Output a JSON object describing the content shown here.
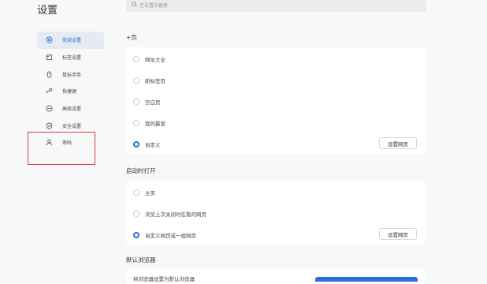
{
  "header": {
    "title": "设置",
    "search_placeholder": "在设置中搜索"
  },
  "sidebar": {
    "items": [
      {
        "label": "常规设置",
        "icon": "settings-circle-icon",
        "active": true
      },
      {
        "label": "标签设置",
        "icon": "tab-icon",
        "active": false
      },
      {
        "label": "鼠标手势",
        "icon": "mouse-icon",
        "active": false
      },
      {
        "label": "快捷键",
        "icon": "shortcut-icon",
        "active": false
      },
      {
        "label": "高级设置",
        "icon": "advanced-icon",
        "active": false
      },
      {
        "label": "安全设置",
        "icon": "shield-icon",
        "active": false
      },
      {
        "label": "密码",
        "icon": "user-icon",
        "active": false
      }
    ]
  },
  "new_tab": {
    "label": "+页",
    "options": [
      "网址大全",
      "新标签页",
      "空白页",
      "我的最爱",
      "自定义"
    ],
    "selected_index": 4,
    "button_label": "设置网页"
  },
  "startup": {
    "label": "启动时打开",
    "options": [
      "主页",
      "浏览上次关闭时在看的网页",
      "自定义网页或一组网页"
    ],
    "selected_index": 2,
    "button_label": "设置网页"
  },
  "default_browser": {
    "label": "默认浏览器",
    "text": "将浏览器设置为默认浏览器"
  },
  "colors": {
    "accent": "#2b6fd6",
    "highlight_border": "#e0403a"
  }
}
